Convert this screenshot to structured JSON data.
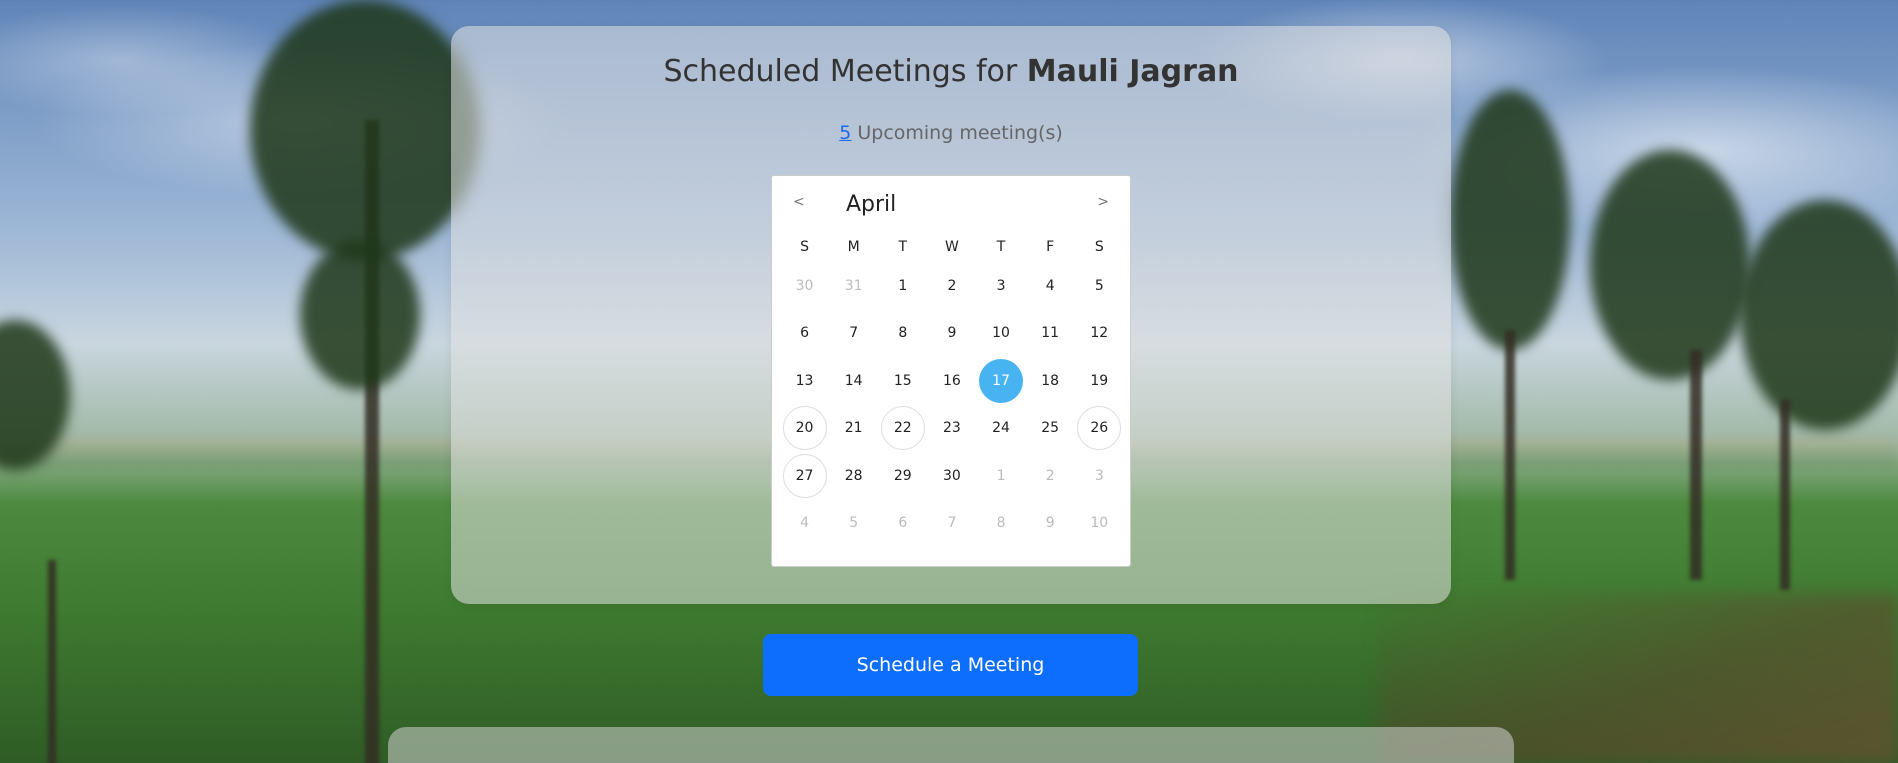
{
  "header": {
    "title_prefix": "Scheduled Meetings for",
    "user_name": "Mauli Jagran"
  },
  "summary": {
    "upcoming_count": "5",
    "upcoming_label": "Upcoming meeting(s)"
  },
  "calendar": {
    "month": "April",
    "prev_label": "<",
    "next_label": ">",
    "weekdays": [
      "S",
      "M",
      "T",
      "W",
      "T",
      "F",
      "S"
    ],
    "weeks": [
      [
        {
          "day": "30",
          "state": "muted"
        },
        {
          "day": "31",
          "state": "muted"
        },
        {
          "day": "1",
          "state": "normal"
        },
        {
          "day": "2",
          "state": "normal"
        },
        {
          "day": "3",
          "state": "normal"
        },
        {
          "day": "4",
          "state": "normal"
        },
        {
          "day": "5",
          "state": "normal"
        }
      ],
      [
        {
          "day": "6",
          "state": "normal"
        },
        {
          "day": "7",
          "state": "normal"
        },
        {
          "day": "8",
          "state": "normal"
        },
        {
          "day": "9",
          "state": "normal"
        },
        {
          "day": "10",
          "state": "normal"
        },
        {
          "day": "11",
          "state": "normal"
        },
        {
          "day": "12",
          "state": "normal"
        }
      ],
      [
        {
          "day": "13",
          "state": "normal"
        },
        {
          "day": "14",
          "state": "normal"
        },
        {
          "day": "15",
          "state": "normal"
        },
        {
          "day": "16",
          "state": "normal"
        },
        {
          "day": "17",
          "state": "today"
        },
        {
          "day": "18",
          "state": "normal"
        },
        {
          "day": "19",
          "state": "normal"
        }
      ],
      [
        {
          "day": "20",
          "state": "meeting"
        },
        {
          "day": "21",
          "state": "normal"
        },
        {
          "day": "22",
          "state": "meeting"
        },
        {
          "day": "23",
          "state": "normal"
        },
        {
          "day": "24",
          "state": "normal"
        },
        {
          "day": "25",
          "state": "normal"
        },
        {
          "day": "26",
          "state": "meeting"
        }
      ],
      [
        {
          "day": "27",
          "state": "meeting"
        },
        {
          "day": "28",
          "state": "normal"
        },
        {
          "day": "29",
          "state": "normal"
        },
        {
          "day": "30",
          "state": "normal"
        },
        {
          "day": "1",
          "state": "muted"
        },
        {
          "day": "2",
          "state": "muted"
        },
        {
          "day": "3",
          "state": "muted"
        }
      ],
      [
        {
          "day": "4",
          "state": "muted"
        },
        {
          "day": "5",
          "state": "muted"
        },
        {
          "day": "6",
          "state": "muted"
        },
        {
          "day": "7",
          "state": "muted"
        },
        {
          "day": "8",
          "state": "muted"
        },
        {
          "day": "9",
          "state": "muted"
        },
        {
          "day": "10",
          "state": "muted"
        }
      ]
    ]
  },
  "actions": {
    "schedule_label": "Schedule a Meeting"
  },
  "colors": {
    "today": "#47b3f0",
    "primary_button": "#0d6efd",
    "link": "#1a6cf0"
  }
}
